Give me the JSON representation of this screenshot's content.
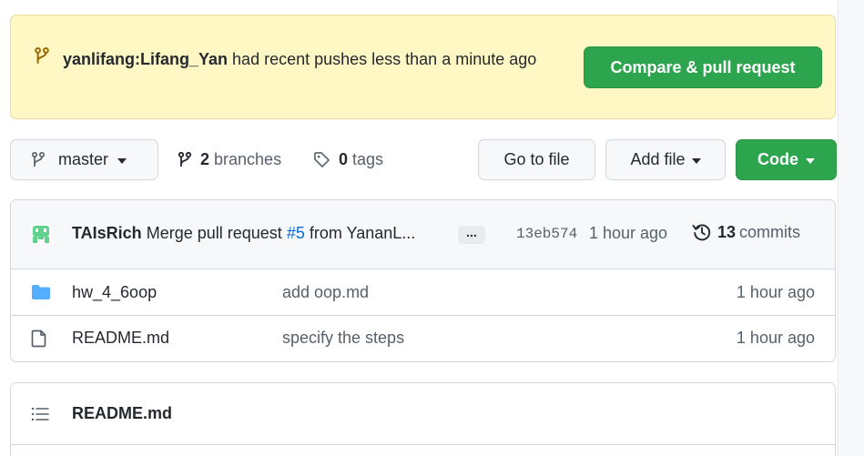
{
  "banner": {
    "branch_ref": "yanlifang:Lifang_Yan",
    "message": "had recent pushes less than a minute ago",
    "compare_label": "Compare & pull request"
  },
  "toolbar": {
    "branch_name": "master",
    "branches_count": "2",
    "branches_label": "branches",
    "tags_count": "0",
    "tags_label": "tags",
    "go_to_file": "Go to file",
    "add_file": "Add file",
    "code": "Code"
  },
  "latest_commit": {
    "author": "TAIsRich",
    "message_prefix": "Merge pull request",
    "pr_link": "#5",
    "message_suffix": "from YananL...",
    "ellipsis": "...",
    "sha": "13eb574",
    "time": "1 hour ago",
    "commits_count": "13",
    "commits_label": "commits"
  },
  "files": [
    {
      "name": "hw_4_6oop",
      "type": "folder",
      "message": "add oop.md",
      "time": "1 hour ago"
    },
    {
      "name": "README.md",
      "type": "file",
      "message": "specify the steps",
      "time": "1 hour ago"
    }
  ],
  "readme": {
    "title": "README.md"
  },
  "colors": {
    "accent_green": "#2da44e",
    "banner_bg": "#fff8c5",
    "link_blue": "#0969da",
    "folder_blue": "#54aeff"
  },
  "icons": [
    "git-branch-icon",
    "tag-icon",
    "history-icon",
    "folder-icon",
    "file-icon",
    "list-icon",
    "avatar-icon"
  ]
}
